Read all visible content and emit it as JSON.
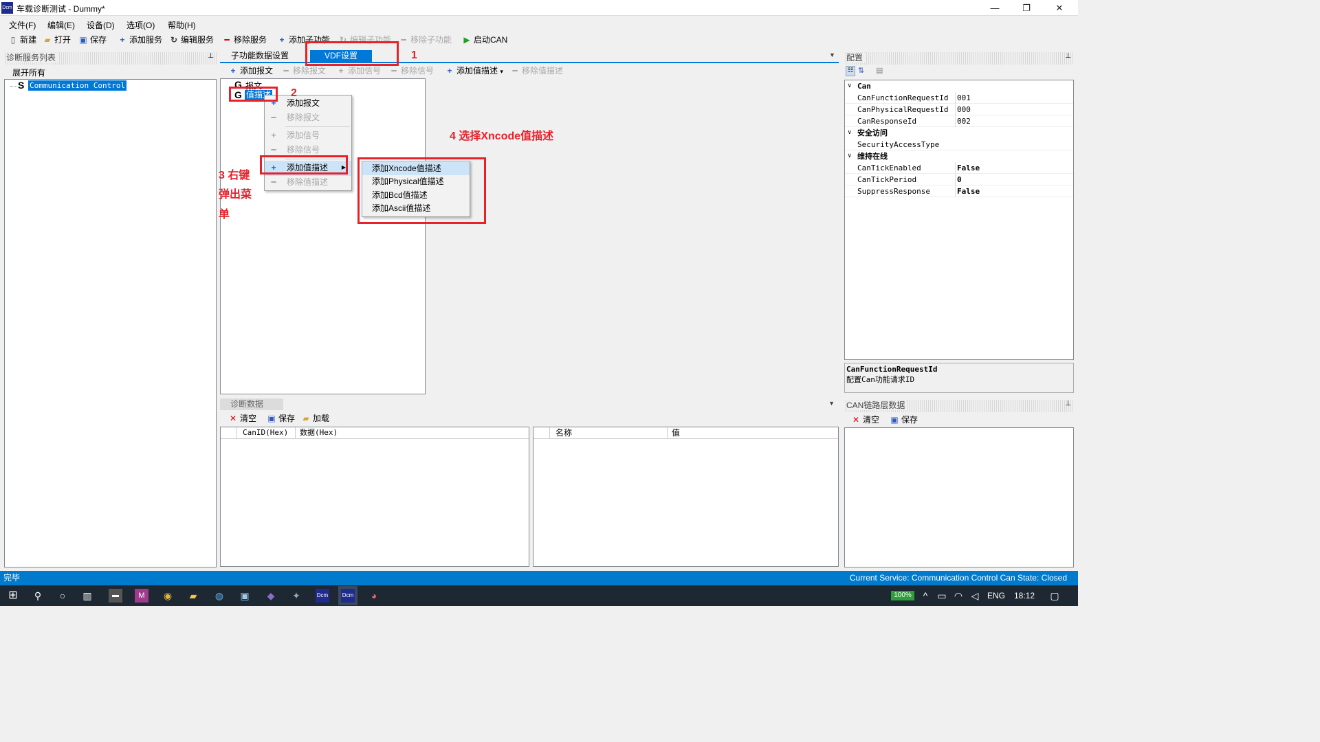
{
  "window": {
    "title": "车载诊断测试 - Dummy*",
    "app_icon": "Dcm",
    "controls": [
      "—",
      "❐",
      "✕"
    ]
  },
  "menu": [
    "文件(F)",
    "编辑(E)",
    "设备(D)",
    "选项(O)",
    "帮助(H)"
  ],
  "toolbar": [
    {
      "label": "新建",
      "icon": "new-file-icon"
    },
    {
      "label": "打开",
      "icon": "open-folder-icon"
    },
    {
      "label": "保存",
      "icon": "save-icon"
    },
    {
      "label": "添加服务",
      "icon": "plus-icon"
    },
    {
      "label": "编辑服务",
      "icon": "edit-icon"
    },
    {
      "label": "移除服务",
      "icon": "minus-icon"
    },
    {
      "label": "添加子功能",
      "icon": "plus-icon"
    },
    {
      "label": "编辑子功能",
      "icon": "edit-icon",
      "disabled": true
    },
    {
      "label": "移除子功能",
      "icon": "minus-icon",
      "disabled": true
    },
    {
      "label": "启动CAN",
      "icon": "play-icon"
    }
  ],
  "left_panel": {
    "title": "诊断服务列表",
    "expand_all": "展开所有",
    "tree": [
      {
        "prefix": "S",
        "label": "Communication Control"
      }
    ]
  },
  "center": {
    "tabs": [
      "子功能数据设置",
      "VDF设置"
    ],
    "active_tab": "VDF设置",
    "subtoolbar": [
      {
        "label": "添加报文",
        "disabled": false
      },
      {
        "label": "移除报文",
        "disabled": true
      },
      {
        "label": "添加信号",
        "disabled": true
      },
      {
        "label": "移除信号",
        "disabled": true
      },
      {
        "label": "添加值描述",
        "disabled": false,
        "dropdown": "▾"
      },
      {
        "label": "移除值描述",
        "disabled": true
      }
    ],
    "tree": [
      {
        "prefix": "G",
        "label": "报文"
      },
      {
        "prefix": "G",
        "label": "值描述"
      }
    ],
    "context_menu": [
      {
        "label": "添加报文",
        "icon": "plus",
        "disabled": false
      },
      {
        "label": "移除报文",
        "icon": "minus",
        "disabled": true
      },
      {
        "label": "添加信号",
        "icon": "plus",
        "disabled": true
      },
      {
        "label": "移除信号",
        "icon": "minus",
        "disabled": true
      },
      {
        "label": "添加值描述",
        "icon": "plus",
        "disabled": false,
        "submenu": true
      },
      {
        "label": "移除值描述",
        "icon": "minus",
        "disabled": true
      }
    ],
    "submenu": [
      "添加Xncode值描述",
      "添加Physical值描述",
      "添加Bcd值描述",
      "添加Ascii值描述"
    ]
  },
  "annotations": {
    "a1": "1",
    "a2": "2",
    "a3": [
      "3 右键",
      "弹出菜",
      "单"
    ],
    "a4": "4 选择Xncode值描述"
  },
  "config": {
    "title": "配置",
    "groups": [
      {
        "name": "Can",
        "rows": [
          [
            "CanFunctionRequestId",
            "001"
          ],
          [
            "CanPhysicalRequestId",
            "000"
          ],
          [
            "CanResponseId",
            "002"
          ]
        ]
      },
      {
        "name": "安全访问",
        "rows": [
          [
            "SecurityAccessType",
            ""
          ]
        ]
      },
      {
        "name": "维持在线",
        "rows": [
          [
            "CanTickEnabled",
            "False"
          ],
          [
            "CanTickPeriod",
            "0"
          ],
          [
            "SuppressResponse",
            "False"
          ]
        ]
      }
    ],
    "desc_title": "CanFunctionRequestId",
    "desc_text": "配置Can功能请求ID"
  },
  "diag": {
    "title": "诊断数据",
    "buttons": [
      "清空",
      "保存",
      "加载"
    ],
    "table1_cols": [
      "CanID(Hex)",
      "数据(Hex)"
    ],
    "table2_cols": [
      "名称",
      "值"
    ]
  },
  "can": {
    "title": "CAN链路层数据",
    "buttons": [
      "清空",
      "保存"
    ]
  },
  "status": {
    "left": "完毕",
    "right": "Current Service: Communication Control  Can State: Closed"
  },
  "taskbar": {
    "battery": "100%",
    "lang": "ENG",
    "time": "18:12"
  },
  "colors": {
    "accent": "#0078d7",
    "statusbar": "#007acc",
    "annotation": "#e8202a"
  }
}
